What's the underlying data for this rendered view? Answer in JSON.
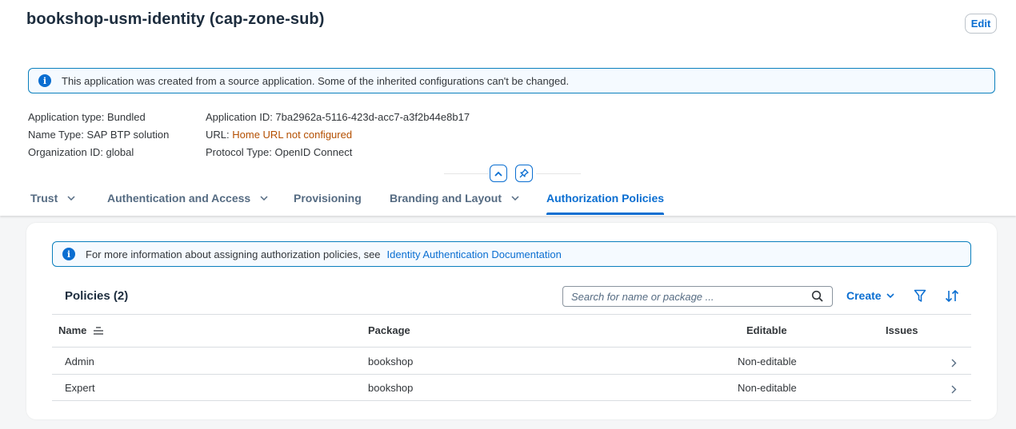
{
  "header": {
    "title": "bookshop-usm-identity (cap-zone-sub)",
    "edit_label": "Edit"
  },
  "info_strip": {
    "text": "This application was created from a source application. Some of the inherited configurations can't be changed."
  },
  "attributes": {
    "app_type": "Application type: Bundled",
    "name_type": "Name Type: SAP BTP solution",
    "org_id": "Organization ID: global",
    "app_id": "Application ID: 7ba2962a-5116-423d-acc7-a3f2b44e8b17",
    "url_label": "URL:",
    "url_value": "Home URL not configured",
    "protocol": "Protocol Type: OpenID Connect"
  },
  "tabs": [
    {
      "label": "Trust"
    },
    {
      "label": "Authentication and Access"
    },
    {
      "label": "Provisioning"
    },
    {
      "label": "Branding and Layout"
    },
    {
      "label": "Authorization Policies"
    }
  ],
  "policies_info": {
    "text": "For more information about assigning authorization policies, see",
    "link": "Identity Authentication Documentation"
  },
  "policies": {
    "title": "Policies (2)",
    "search_placeholder": "Search for name or package ...",
    "create_label": "Create",
    "columns": [
      "Name",
      "Package",
      "Editable",
      "Issues"
    ],
    "rows": [
      {
        "name": "Admin",
        "package": "bookshop",
        "editable": "Non-editable"
      },
      {
        "name": "Expert",
        "package": "bookshop",
        "editable": "Non-editable"
      }
    ]
  },
  "colors": {
    "accent": "#0a6ed1",
    "warning_link": "#b44f00",
    "info_border": "#0a7fbd"
  },
  "icons": [
    "info-icon",
    "collapse-icon",
    "pin-icon",
    "chevron-down-icon",
    "search-icon",
    "filter-icon",
    "sort-icon",
    "chevron-right-icon"
  ]
}
